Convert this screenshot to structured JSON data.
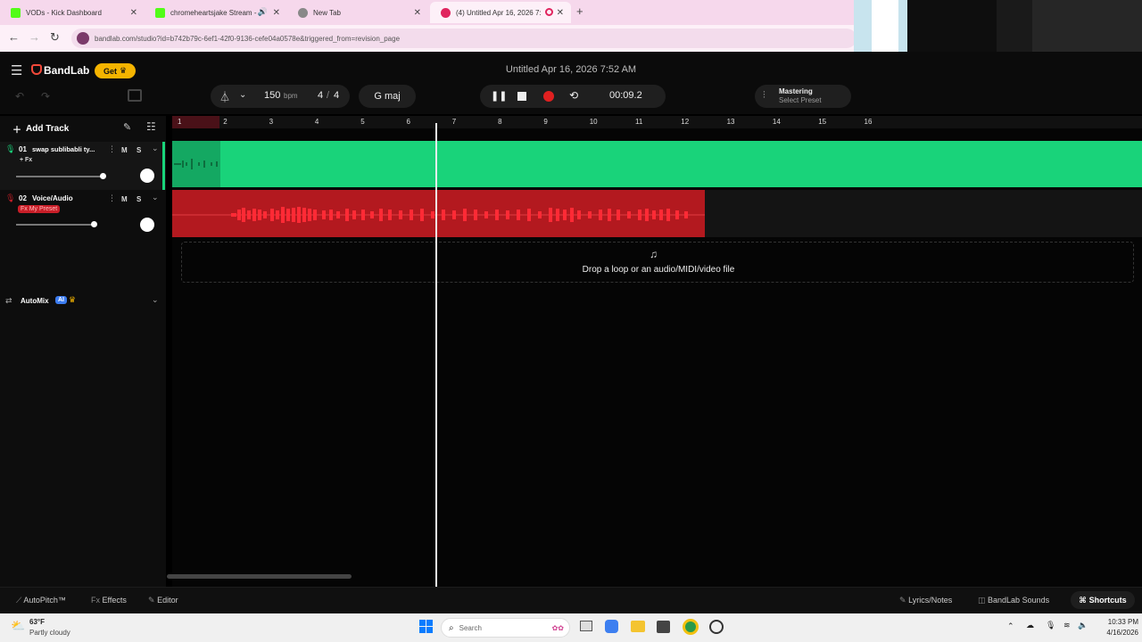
{
  "browser": {
    "tabs": [
      {
        "title": "VODs - Kick Dashboard",
        "color": "#53fc18"
      },
      {
        "title": "chromeheartsjake Stream -",
        "color": "#53fc18"
      },
      {
        "title": "New Tab",
        "color": "#666666"
      },
      {
        "title": "(4) Untitled Apr 16, 2026 7:",
        "color": "#e0245e"
      }
    ],
    "new_tab": "+",
    "url": "bandlab.com/studio?id=b742b79c-6ef1-42f0-9136-cefe04a0578e&triggered_from=revision_page"
  },
  "app": {
    "brand": "BandLab",
    "get_label": "Get",
    "project_title": "Untitled Apr 16, 2026 7:52 AM",
    "bpm": "150",
    "bpm_unit": "bpm",
    "time_sig_num": "4",
    "time_sig_sep": "/",
    "time_sig_den": "4",
    "key": "G maj",
    "time": "00:09.2",
    "mastering": {
      "title": "Mastering",
      "sub": "Select Preset"
    },
    "add_track": "Add Track",
    "ruler_ticks": [
      "1",
      "2",
      "3",
      "4",
      "5",
      "6",
      "7",
      "8",
      "9",
      "10",
      "11",
      "12",
      "13",
      "14",
      "15",
      "16"
    ],
    "tracks": [
      {
        "num": "01",
        "name": "swap sublibabli ty...",
        "fx": "+ Fx",
        "mute": "M",
        "solo": "S",
        "color": "#19d37a"
      },
      {
        "num": "02",
        "name": "Voice/Audio",
        "fx": "Fx My Preset",
        "mute": "M",
        "solo": "S",
        "color": "#c81e28"
      }
    ],
    "automix": {
      "label": "AutoMix",
      "badge": "AI"
    },
    "drop_text": "Drop a loop or an audio/MIDI/video file",
    "bottom": {
      "autopitch": "AutoPitch™",
      "effects": "Effects",
      "editor": "Editor",
      "lyrics": "Lyrics/Notes",
      "sounds": "BandLab Sounds",
      "shortcuts": "Shortcuts"
    }
  },
  "taskbar": {
    "weather_temp": "63°F",
    "weather_desc": "Partly cloudy",
    "search": "Search",
    "clock_time": "10:33 PM",
    "clock_date": "4/16/2026"
  },
  "colors": {
    "accent_green": "#19d37a",
    "accent_red": "#c81e28",
    "brand_red": "#f2493a",
    "get_yellow": "#f5b400"
  }
}
